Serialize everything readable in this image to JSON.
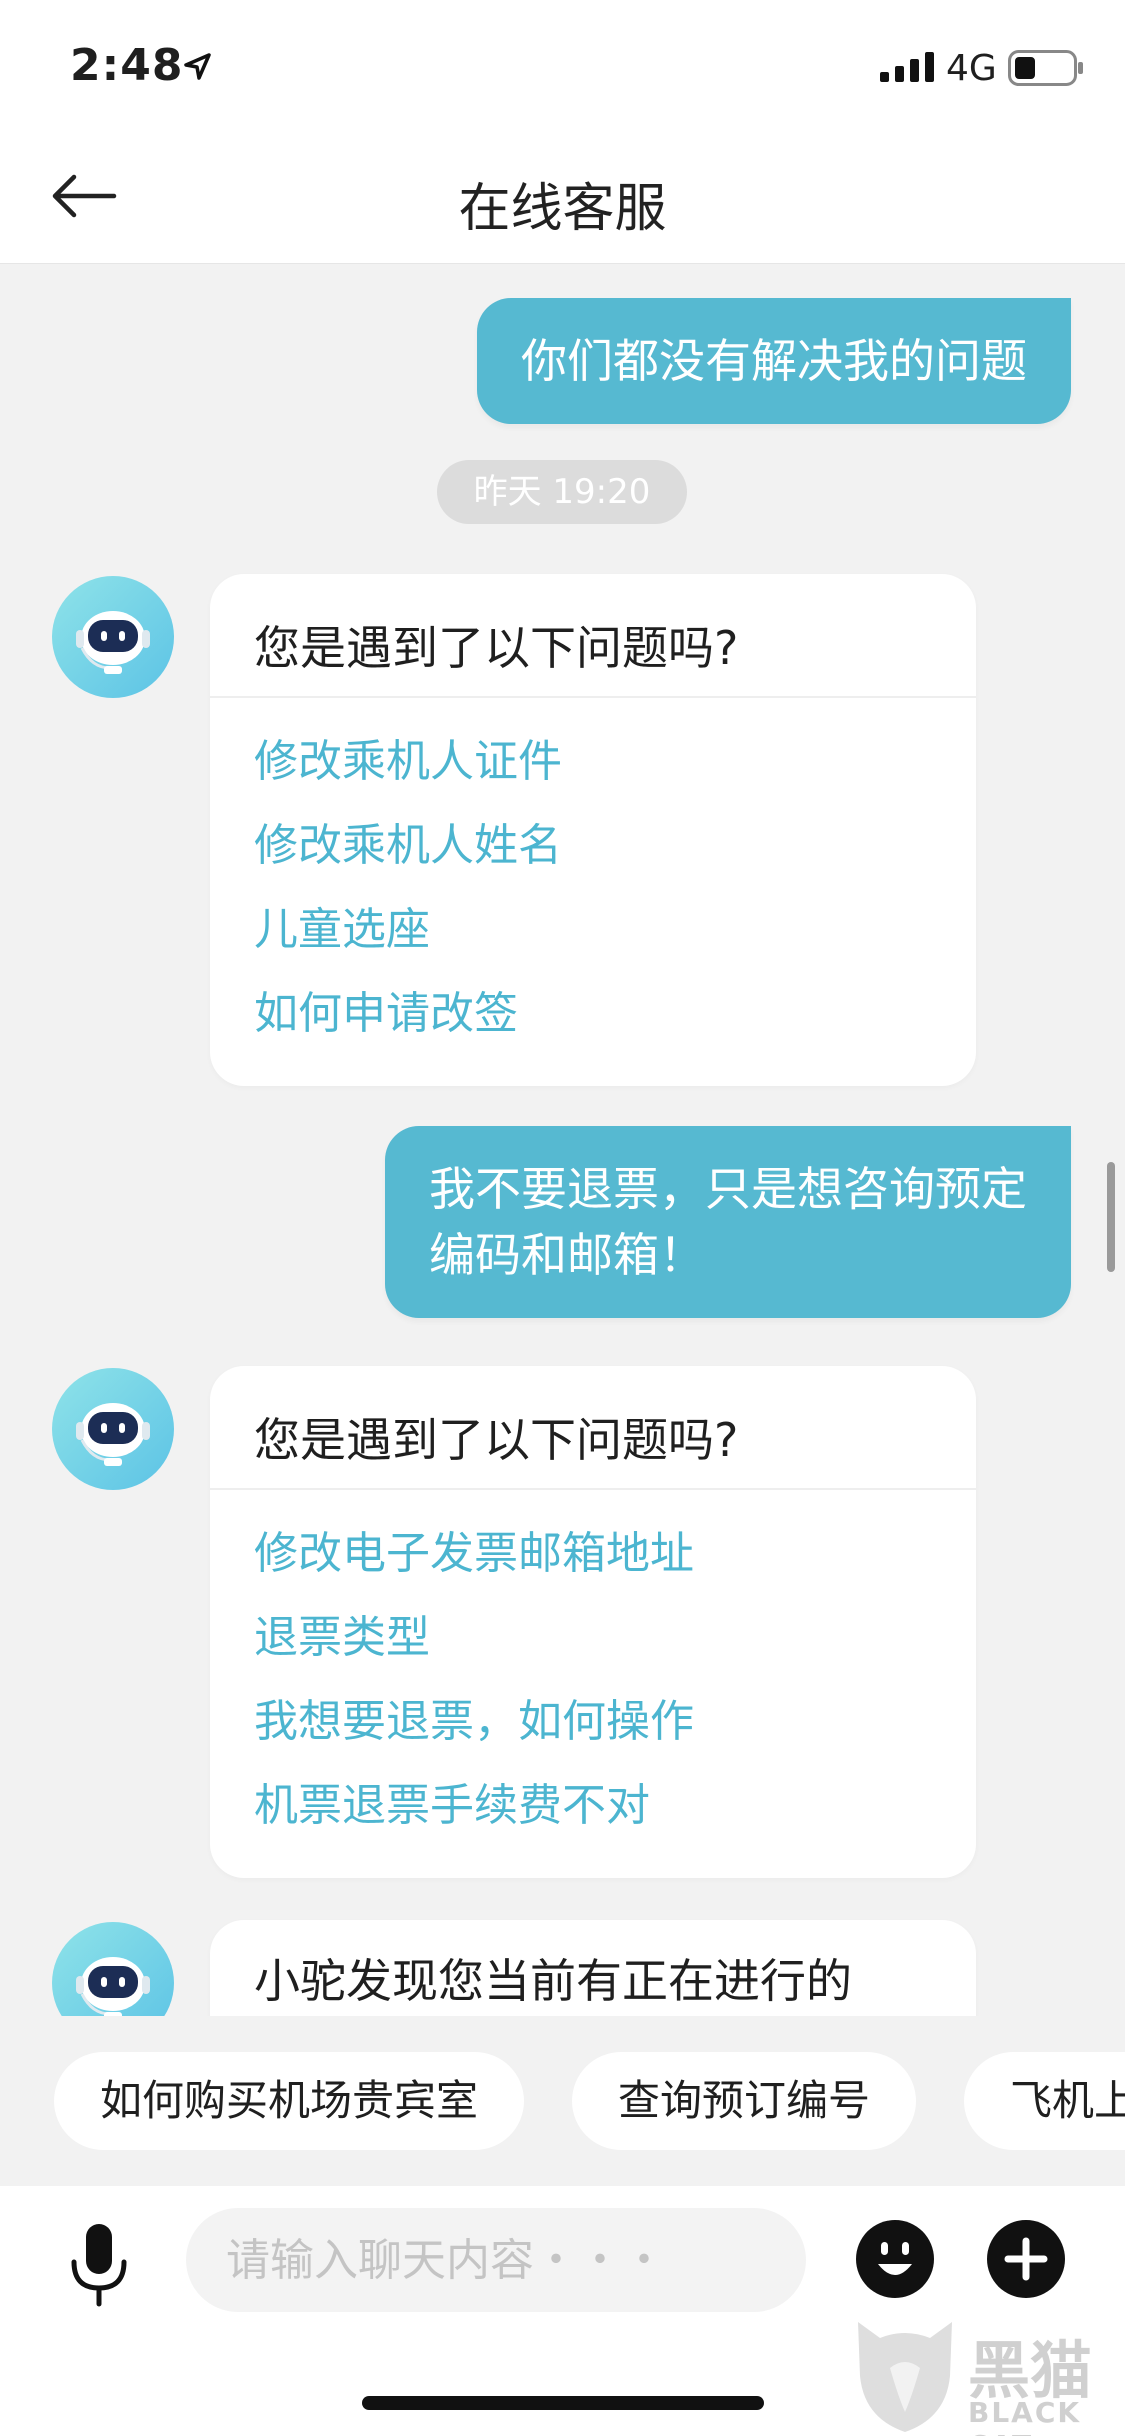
{
  "status_bar": {
    "time": "2:48",
    "network": "4G"
  },
  "nav": {
    "title": "在线客服"
  },
  "chat": {
    "messages": [
      {
        "type": "user",
        "text": "你们都没有解决我的问题"
      },
      {
        "type": "timestamp",
        "text": "昨天 19:20"
      },
      {
        "type": "bot_card",
        "question": "您是遇到了以下问题吗?",
        "options": [
          "修改乘机人证件",
          "修改乘机人姓名",
          "儿童选座",
          "如何申请改签"
        ]
      },
      {
        "type": "user",
        "lines": [
          "我不要退票，只是想咨询预定",
          "编码和邮箱！"
        ]
      },
      {
        "type": "bot_card",
        "question": "您是遇到了以下问题吗?",
        "options": [
          "修改电子发票邮箱地址",
          "退票类型",
          "我想要退票，如何操作",
          "机票退票手续费不对"
        ]
      },
      {
        "type": "bot_text",
        "text": "小驼发现您当前有正在进行的"
      }
    ]
  },
  "quick_replies": [
    "如何购买机场贵宾室",
    "查询预订编号",
    "飞机上"
  ],
  "input": {
    "placeholder": "请输入聊天内容・・・"
  },
  "watermark": {
    "logo_text": "黑猫",
    "sub_text": "BLACK CAT"
  },
  "colors": {
    "accent": "#56b9d1",
    "link": "#4cb5d0",
    "background": "#f2f2f2"
  },
  "icons": [
    "location-arrow-icon",
    "signal-icon",
    "battery-icon",
    "back-arrow-icon",
    "robot-avatar-icon",
    "microphone-icon",
    "emoji-icon",
    "plus-icon"
  ]
}
